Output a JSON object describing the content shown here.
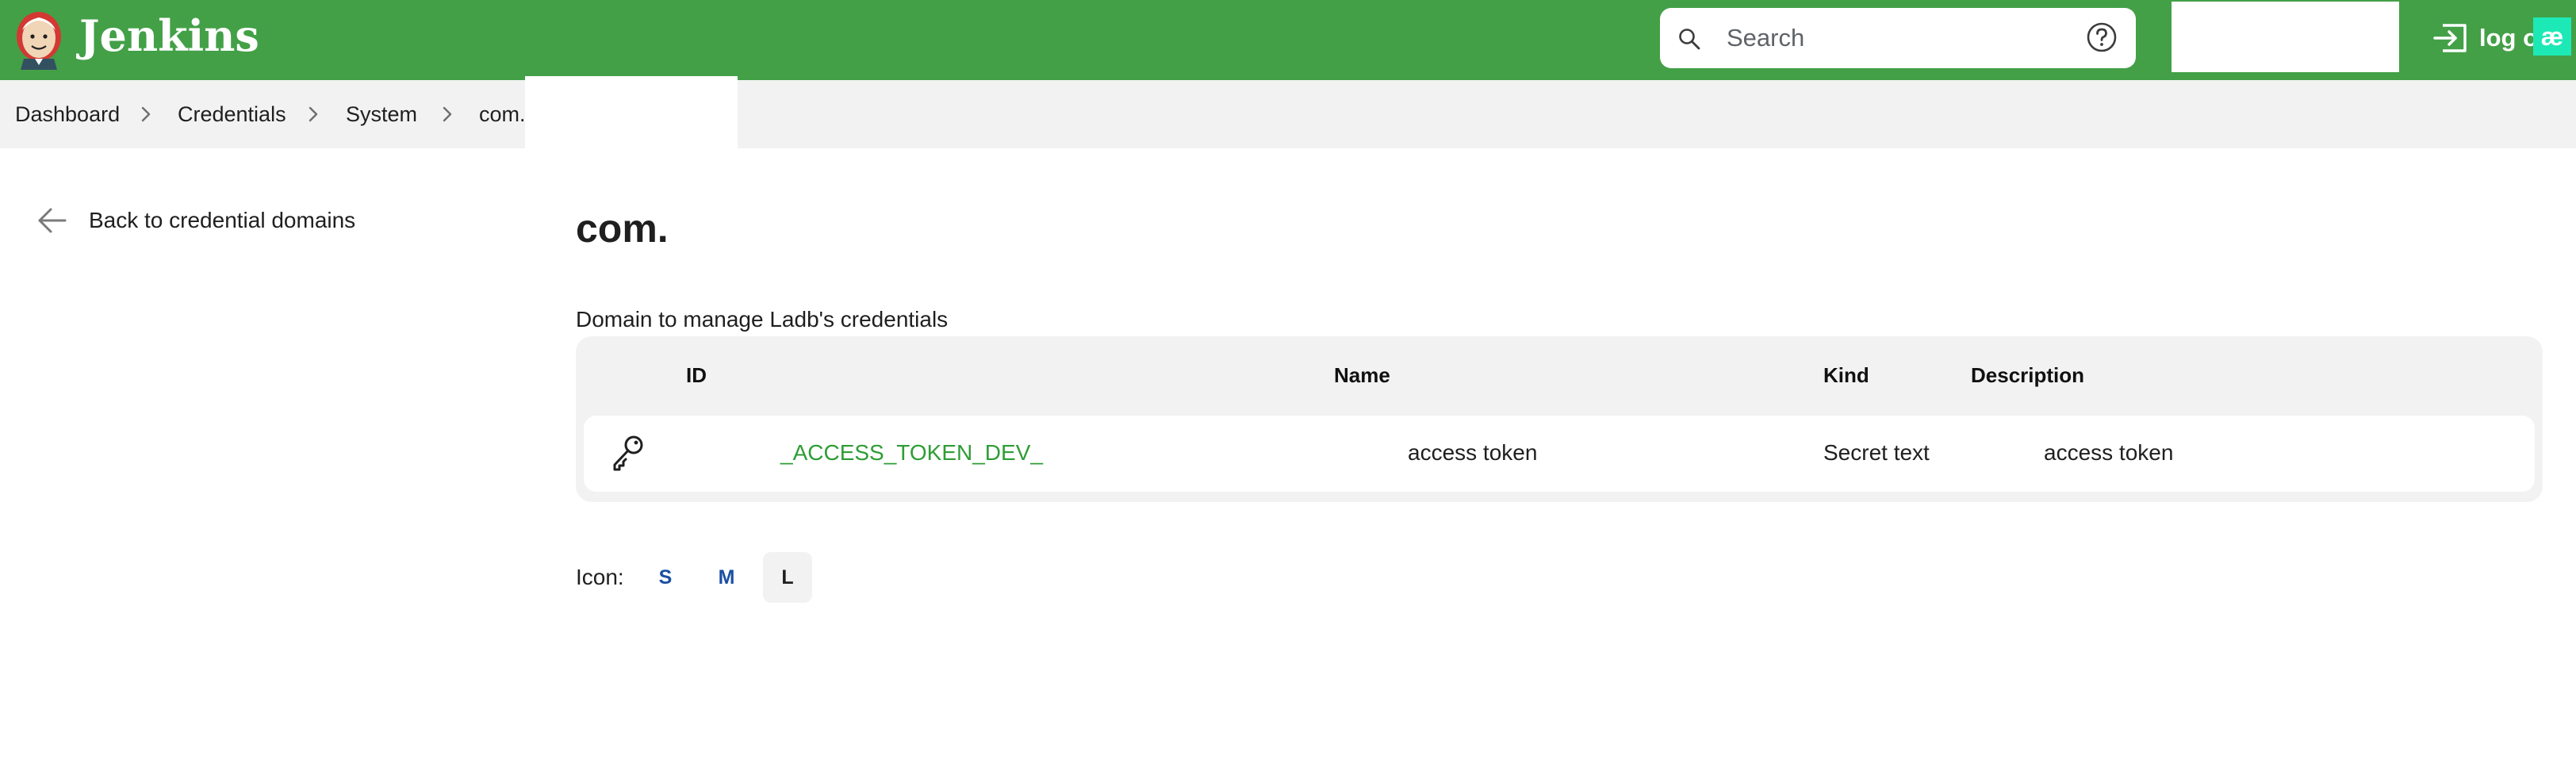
{
  "header": {
    "brand": "Jenkins",
    "search": {
      "placeholder": "Search",
      "value": ""
    },
    "logout_label": "log o",
    "extension_badge": "æ",
    "colors": {
      "background": "#43a047",
      "badge": "#1de9b6"
    }
  },
  "breadcrumb": {
    "items": [
      "Dashboard",
      "Credentials",
      "System",
      "com."
    ]
  },
  "sidebar": {
    "back_label": "Back to credential domains"
  },
  "main": {
    "title": "com.",
    "description": "Domain to manage Ladb's credentials",
    "table": {
      "headers": [
        "ID",
        "Name",
        "Kind",
        "Description"
      ],
      "rows": [
        {
          "icon": "key-icon",
          "id": "_ACCESS_TOKEN_DEV_",
          "name": "access token",
          "kind": "Secret text",
          "description": "access token"
        }
      ]
    },
    "icon_size": {
      "label": "Icon:",
      "options": [
        "S",
        "M",
        "L"
      ],
      "selected": "L"
    },
    "link_color": "#2e9d36"
  }
}
